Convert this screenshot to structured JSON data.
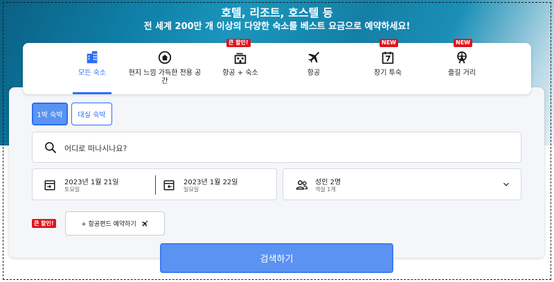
{
  "hero": {
    "title": "호텔, 리조트, 호스텔 등",
    "subtitle": "전 세계 200만 개 이상의 다양한 숙소를 베스트 요금으로 예약하세요!"
  },
  "tabs": [
    {
      "label": "모든 숙소",
      "icon": "building-icon",
      "active": true,
      "badge": ""
    },
    {
      "label": "현지 느낌 가득한 전용 공간",
      "icon": "home-icon",
      "active": false,
      "badge": ""
    },
    {
      "label": "항공 + 숙소",
      "icon": "flight-hotel-icon",
      "active": false,
      "badge": "큰 할인!"
    },
    {
      "label": "항공",
      "icon": "airplane-icon",
      "active": false,
      "badge": ""
    },
    {
      "label": "장기 투숙",
      "icon": "calendar-seven-icon",
      "active": false,
      "badge": "NEW"
    },
    {
      "label": "즐길 거리",
      "icon": "ferris-wheel-icon",
      "active": false,
      "badge": "NEW"
    }
  ],
  "stay_type": {
    "option_1": "1박 숙박",
    "option_2": "대실 숙박",
    "selected": "1박 숙박"
  },
  "search": {
    "placeholder": "어디로 떠나시나요?"
  },
  "dates": {
    "checkin_date": "2023년 1월 21일",
    "checkin_day": "토요일",
    "checkout_date": "2023년 1월 22일",
    "checkout_day": "일요일"
  },
  "guests": {
    "adults": "성인 2명",
    "rooms": "객실 1개"
  },
  "flight_addon": {
    "badge": "큰 할인!",
    "label": "+ 항공편드 예약하기"
  },
  "search_button": "검색하기",
  "colors": {
    "accent": "#2a6ef5",
    "button": "#5b93f3",
    "badge": "#e0151d"
  }
}
